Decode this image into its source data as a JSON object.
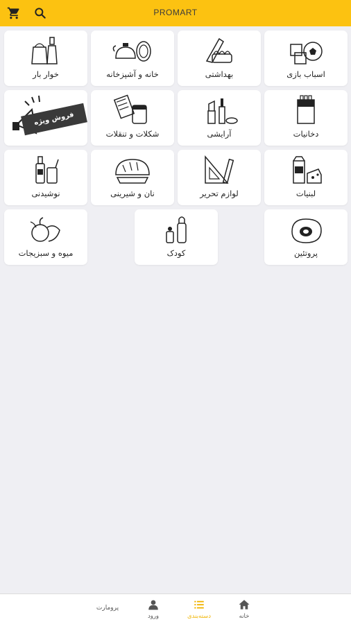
{
  "header": {
    "brand": "PROMART",
    "cart_icon": "cart-icon",
    "search_icon": "search-icon",
    "background": "#fcc211"
  },
  "categories": [
    {
      "label": "اسباب بازی",
      "icon": "toys-icon"
    },
    {
      "label": "بهداشتی",
      "icon": "hygiene-icon"
    },
    {
      "label": "خانه و آشپزخانه",
      "icon": "kitchen-icon"
    },
    {
      "label": "خوار بار",
      "icon": "groceries-icon"
    },
    {
      "label": "دخانیات",
      "icon": "tobacco-icon"
    },
    {
      "label": "آرایشی",
      "icon": "cosmetics-icon"
    },
    {
      "label": "شکلات و تنقلات",
      "icon": "snacks-icon"
    },
    {
      "label": "فروش ویژه",
      "icon": "megaphone-icon"
    },
    {
      "label": "لبنیات",
      "icon": "dairy-icon"
    },
    {
      "label": "لوازم تحریر",
      "icon": "stationery-icon"
    },
    {
      "label": "نان و شیرینی",
      "icon": "bread-icon"
    },
    {
      "label": "نوشیدنی",
      "icon": "drinks-icon"
    },
    {
      "label": "پروتئین",
      "icon": "protein-icon"
    },
    {
      "label": "کودک",
      "icon": "baby-icon"
    },
    {
      "label": "میوه و سبزیجات",
      "icon": "produce-icon"
    }
  ],
  "bottom_nav": {
    "home": "خانه",
    "categories": "دسته‌بندی",
    "login": "ورود",
    "promart": "پرومارت",
    "active_color": "#f0b400"
  }
}
